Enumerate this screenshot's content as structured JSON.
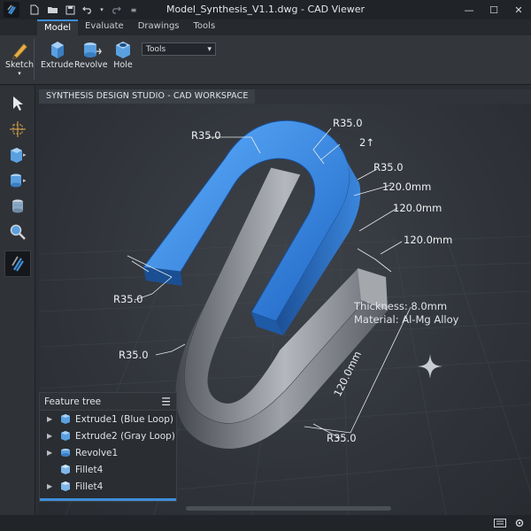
{
  "window": {
    "title": "Model_Synthesis_V1.1.dwg - CAD Viewer",
    "controls": [
      "—",
      "☐",
      "✕"
    ]
  },
  "quick_access": {
    "icons": [
      "new-file-icon",
      "open-folder-icon",
      "save-icon",
      "undo-icon",
      "redo-icon",
      "customize-icon"
    ]
  },
  "ribbon": {
    "tabs": [
      {
        "label": "Model",
        "active": true
      },
      {
        "label": "Evaluate",
        "active": false
      },
      {
        "label": "Drawings",
        "active": false
      },
      {
        "label": "Tools",
        "active": false
      }
    ],
    "sketch_label": "Sketch",
    "extrude_label": "Extrude",
    "revolve_label": "Revolve",
    "hole_label": "Hole",
    "tools_select": {
      "value": "Tools",
      "arrow": "▾"
    }
  },
  "left_toolbar": {
    "tools": [
      "select-arrow-icon",
      "move-transform-icon",
      "extrude-box-icon",
      "revolve-cylinder-icon",
      "cylinder-icon",
      "zoom-icon",
      "app-logo-icon"
    ]
  },
  "viewport": {
    "tab_label": "SYNTHESIS DESIGN STUDIO - CAD WORKSPACE",
    "dimensions": {
      "r1": "R35.0",
      "r2": "R35.0",
      "r3": "R35.0",
      "r4": "R35.0",
      "r5": "R35.0",
      "r6": "R35.0",
      "d1": "120.0mm",
      "d2": "120.0mm",
      "d3": "120.0mm",
      "d4": "120.0mm",
      "t": "2↑"
    },
    "info": {
      "thickness": "Thickness: 8.0mm",
      "material": "Material: Al-Mg Alloy"
    },
    "colors": {
      "blue_part": "#2f7fd8",
      "gray_part": "#8a8d92"
    }
  },
  "feature_tree": {
    "title": "Feature tree",
    "items": [
      {
        "label": "Extrude1 (Blue Loop)",
        "icon": "extrude-box-icon"
      },
      {
        "label": "Extrude2 (Gray Loop)",
        "icon": "extrude-box-icon"
      },
      {
        "label": "Revolve1",
        "icon": "revolve-icon"
      },
      {
        "label": "Fillet4",
        "icon": "fillet-icon"
      },
      {
        "label": "Fillet4",
        "icon": "fillet-icon"
      }
    ]
  }
}
